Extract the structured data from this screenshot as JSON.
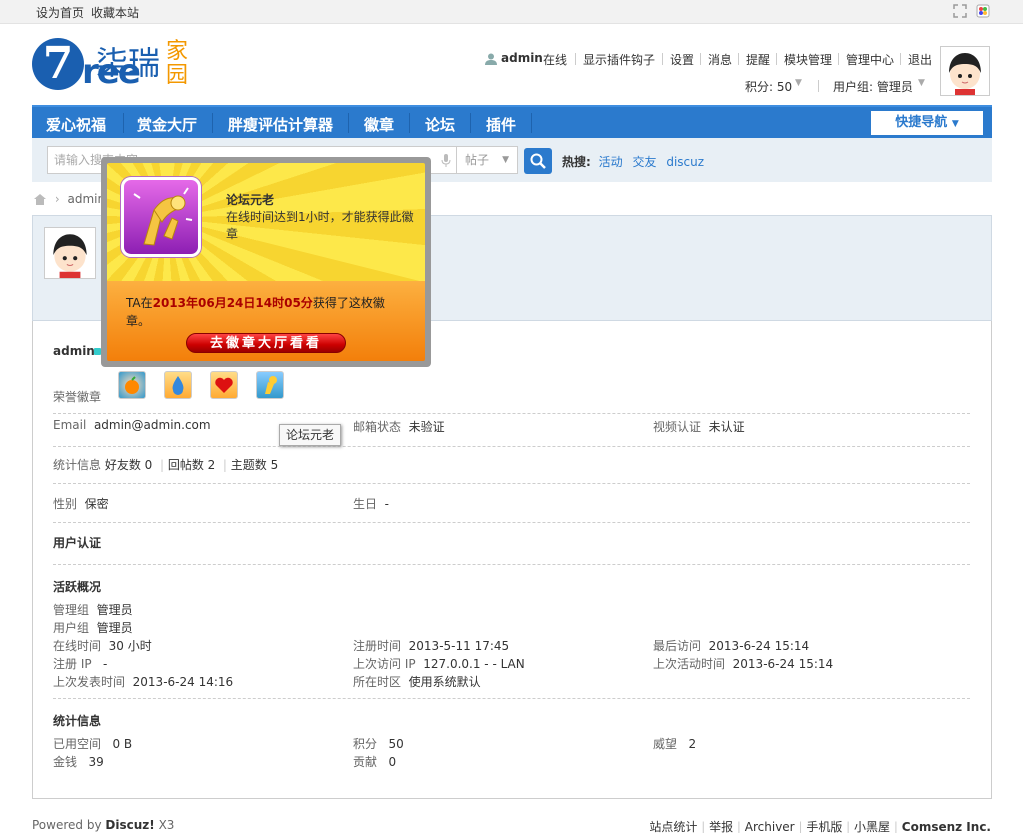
{
  "topbar": {
    "set_home": "设为首页",
    "bookmark": "收藏本站"
  },
  "logo": {
    "seven": "7",
    "ree": "ree",
    "cn": "柒瑞",
    "jia": "家园"
  },
  "userbar": {
    "username": "admin",
    "online": "在线",
    "plugin_hooks": "显示插件钩子",
    "settings": "设置",
    "messages": "消息",
    "reminders": "提醒",
    "module_mgmt": "模块管理",
    "admin_center": "管理中心",
    "logout": "退出",
    "points": "积分: 50",
    "usergroup": "用户组: 管理员"
  },
  "nav": {
    "items": [
      "爱心祝福",
      "赏金大厅",
      "胖瘦评估计算器",
      "徽章",
      "论坛",
      "插件"
    ],
    "quick": "快捷导航"
  },
  "search": {
    "placeholder": "请输入搜索内容",
    "type": "帖子",
    "hot_label": "热搜:",
    "hot": [
      "活动",
      "交友",
      "discuz"
    ]
  },
  "breadcrumb": {
    "user": "admin"
  },
  "popup": {
    "title": "论坛元老",
    "desc": "在线时间达到1小时，才能获得此徽章",
    "got_prefix": "TA在",
    "got_time": "2013年06月24日14时05分",
    "got_suffix": "获得了这枚徽",
    "got_suffix2": "章。",
    "button": "去徽章大厅看看"
  },
  "tooltip": "论坛元老",
  "profile": {
    "name": "admin",
    "badges_label": "荣誉徽章",
    "email_label": "Email",
    "email": "admin@admin.com",
    "mail_status_label": "邮箱状态",
    "mail_status": "未验证",
    "video_label": "视频认证",
    "video": "未认证",
    "stats_label": "统计信息",
    "friends": "好友数 0",
    "replies": "回帖数 2",
    "threads": "主题数 5",
    "gender_label": "性别",
    "gender": "保密",
    "birthday_label": "生日",
    "birthday": "-",
    "auth_title": "用户认证",
    "activity_title": "活跃概况",
    "admin_group_label": "管理组",
    "admin_group": "管理员",
    "user_group_label": "用户组",
    "user_group": "管理员",
    "online_label": "在线时间",
    "online": "30 小时",
    "reg_time_label": "注册时间",
    "reg_time": "2013-5-11 17:45",
    "last_visit_label": "最后访问",
    "last_visit": "2013-6-24 15:14",
    "reg_ip_label": "注册 IP",
    "reg_ip": "-",
    "last_ip_label": "上次访问 IP",
    "last_ip": "127.0.0.1 - - LAN",
    "last_active_label": "上次活动时间",
    "last_active": "2013-6-24 15:14",
    "last_post_label": "上次发表时间",
    "last_post": "2013-6-24 14:16",
    "tz_label": "所在时区",
    "tz": "使用系统默认",
    "stat_title": "统计信息",
    "space_label": "已用空间",
    "space": "0 B",
    "points_label": "积分",
    "points": "50",
    "prestige_label": "威望",
    "prestige": "2",
    "money_label": "金钱",
    "money": "39",
    "contrib_label": "贡献",
    "contrib": "0"
  },
  "footer": {
    "powered": "Powered by",
    "brand": "Discuz!",
    "ver": "X3",
    "links": [
      "站点统计",
      "举报",
      "Archiver",
      "手机版",
      "小黑屋"
    ],
    "company": "Comsenz Inc."
  }
}
